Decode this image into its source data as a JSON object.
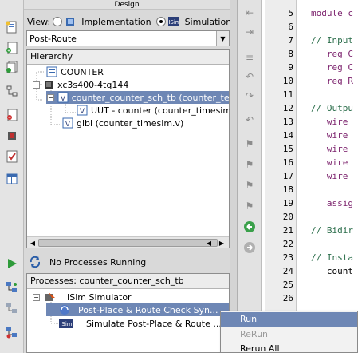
{
  "design_panel": {
    "title": "Design",
    "view_label": "View:",
    "view_options": [
      "Implementation",
      "Simulation"
    ],
    "selected_view": "Simulation",
    "dropdown_value": "Post-Route"
  },
  "hierarchy": {
    "header": "Hierarchy",
    "items": [
      {
        "label": "COUNTER"
      },
      {
        "label": "xc3s400-4tq144"
      },
      {
        "label": "counter_counter_sch_tb (counter_tes"
      },
      {
        "label": "UUT - counter (counter_timesim."
      },
      {
        "label": "glbl (counter_timesim.v)"
      }
    ]
  },
  "process_status": "No Processes Running",
  "processes": {
    "header": "Processes: counter_counter_sch_tb",
    "items": [
      {
        "label": "ISim Simulator"
      },
      {
        "label": "Post-Place & Route Check Syn..."
      },
      {
        "label": "Simulate Post-Place & Route ..."
      }
    ]
  },
  "editor": {
    "line_numbers": [
      "5",
      "6",
      "7",
      "8",
      "9",
      "10",
      "11",
      "12",
      "13",
      "14",
      "15",
      "16",
      "17",
      "18",
      "19",
      "20",
      "21",
      "22",
      "23",
      "24",
      "25",
      "26"
    ],
    "lines": [
      {
        "text": "module c",
        "kind": "kw"
      },
      {
        "text": "",
        "kind": "pl"
      },
      {
        "text": "// Input",
        "kind": "cm"
      },
      {
        "text": "   reg C",
        "kind": "kw"
      },
      {
        "text": "   reg C",
        "kind": "kw"
      },
      {
        "text": "   reg R",
        "kind": "kw"
      },
      {
        "text": "",
        "kind": "pl"
      },
      {
        "text": "// Outpu",
        "kind": "cm"
      },
      {
        "text": "   wire",
        "kind": "kw"
      },
      {
        "text": "   wire",
        "kind": "kw"
      },
      {
        "text": "   wire",
        "kind": "kw"
      },
      {
        "text": "   wire",
        "kind": "kw"
      },
      {
        "text": "   wire",
        "kind": "kw"
      },
      {
        "text": "",
        "kind": "pl"
      },
      {
        "text": "   assig",
        "kind": "kw"
      },
      {
        "text": "",
        "kind": "pl"
      },
      {
        "text": "// Bidir",
        "kind": "cm"
      },
      {
        "text": "",
        "kind": "pl"
      },
      {
        "text": "// Insta",
        "kind": "cm"
      },
      {
        "text": "   count",
        "kind": "pl"
      },
      {
        "text": "",
        "kind": "pl"
      },
      {
        "text": "",
        "kind": "pl"
      }
    ]
  },
  "context_menu": {
    "items": [
      {
        "label": "Run",
        "state": "highlighted"
      },
      {
        "label": "ReRun",
        "state": "disabled"
      },
      {
        "label": "Rerun All",
        "state": "enabled"
      }
    ]
  },
  "colors": {
    "selection": "#6e87b5",
    "keyword": "#7a1f6b",
    "comment": "#2a6d4a"
  }
}
